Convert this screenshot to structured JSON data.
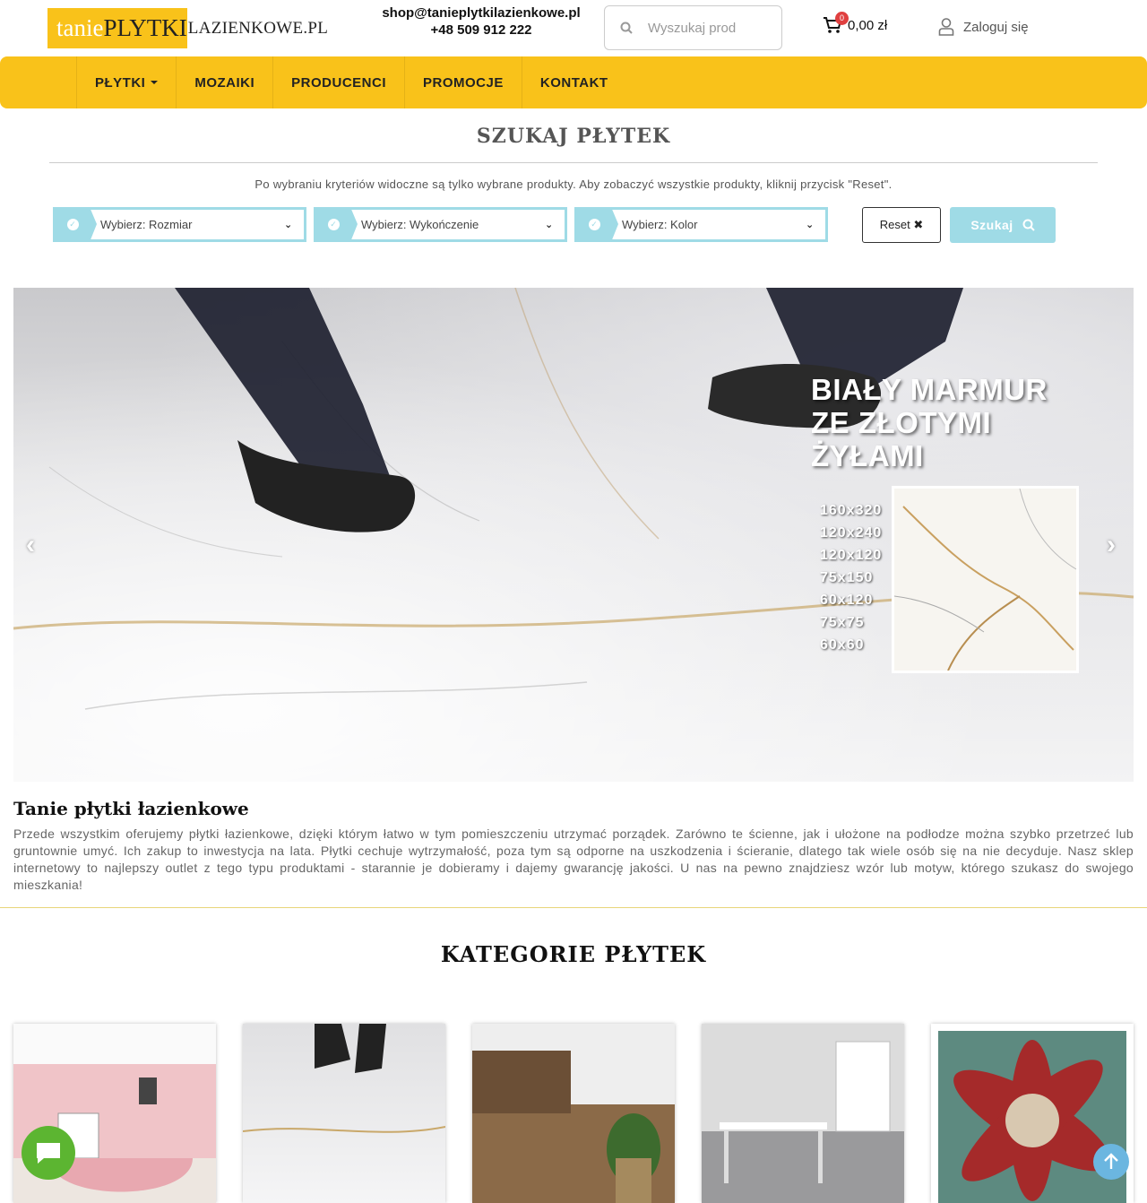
{
  "header": {
    "logo": {
      "tanie": "tanie",
      "plytki": "PLYTKI",
      "rest": "LAZIENKOWE.PL"
    },
    "email": "shop@tanieplytkilazienkowe.pl",
    "phone": "+48 509 912 222",
    "search": {
      "placeholder": "Wyszukaj prod",
      "icon": "search-icon"
    },
    "cart": {
      "count": "0",
      "amount": "0,00 zł",
      "icon": "cart-icon"
    },
    "login": {
      "label": "Zaloguj się",
      "icon": "user-icon"
    }
  },
  "nav": {
    "items": [
      {
        "label": "PŁYTKI",
        "has_dropdown": true
      },
      {
        "label": "MOZAIKI"
      },
      {
        "label": "PRODUCENCI"
      },
      {
        "label": "PROMOCJE"
      },
      {
        "label": "KONTAKT"
      }
    ]
  },
  "filters": {
    "title": "SZUKAJ PŁYTEK",
    "note": "Po wybraniu kryteriów widoczne są tylko wybrane produkty. Aby zobaczyć wszystkie produkty, kliknij przycisk \"Reset\".",
    "selects": [
      {
        "label": "Wybierz: Rozmiar"
      },
      {
        "label": "Wybierz: Wykończenie"
      },
      {
        "label": "Wybierz: Kolor"
      }
    ],
    "reset_label": "Reset ✖",
    "search_label": "Szukaj"
  },
  "hero": {
    "title_lines": [
      "BIAŁY MARMUR",
      "ZE ZŁOTYMI",
      "ŻYŁAMI"
    ],
    "sizes": [
      "160x320",
      "120x240",
      "120x120",
      "75x150",
      "60x120",
      "75x75",
      "60x60"
    ],
    "prev": "‹",
    "next": "›"
  },
  "intro": {
    "title": "Tanie płytki łazienkowe",
    "text": "Przede wszystkim oferujemy płytki łazienkowe, dzięki którym łatwo w tym pomieszczeniu utrzymać porządek. Zarówno te ścienne, jak i ułożone na podłodze można szybko przetrzeć lub gruntownie umyć. Ich zakup to inwestycja na lata. Płytki cechuje wytrzymałość, poza tym są odporne na uszkodzenia i ścieranie, dlatego tak wiele osób się na nie decyduje. Nasz sklep internetowy to najlepszy outlet z tego typu produktami - starannie je dobieramy i dajemy gwarancję jakości. U nas na pewno znajdziesz wzór lub motyw, którego szukasz do swojego mieszkania!"
  },
  "categories": {
    "title": "KATEGORIE PŁYTEK",
    "colors": [
      "#f0c4c8",
      "#e8e8ea",
      "#8b6a48",
      "#b9b9bb",
      "#8a2a2a"
    ]
  },
  "widgets": {
    "chat_icon": "chat-icon",
    "scroll_up_icon": "arrow-up-icon"
  }
}
